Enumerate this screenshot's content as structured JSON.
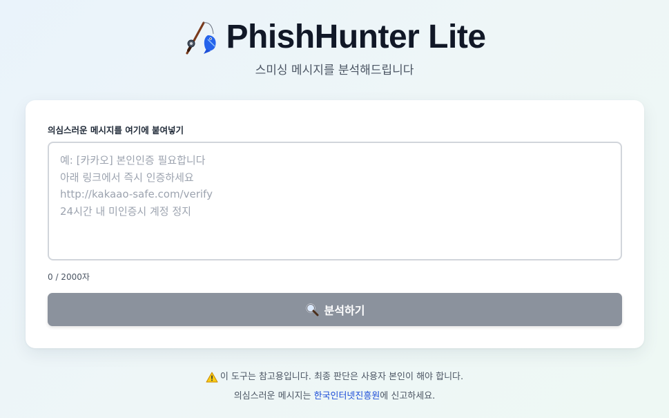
{
  "header": {
    "logo_icon": "fishing-pole-and-fish-icon",
    "title": "PhishHunter Lite",
    "subtitle": "스미싱 메시지를 분석해드립니다"
  },
  "form": {
    "label": "의심스러운 메시지를 여기에 붙여넣기",
    "placeholder": "예: [카카오] 본인인증 필요합니다\n아래 링크에서 즉시 인증하세요\nhttp://kakaao-safe.com/verify\n24시간 내 미인증시 계정 정지",
    "value": "",
    "counter": "0 / 2000자",
    "button_icon": "magnifying-glass-icon",
    "button_label": "분석하기"
  },
  "footer": {
    "warning_icon": "warning-icon",
    "disclaimer": "이 도구는 참고용입니다. 최종 판단은 사용자 본인이 해야 합니다.",
    "report_prefix": "의심스러운 메시지는 ",
    "report_link": "한국인터넷진흥원",
    "report_suffix": "에 신고하세요."
  },
  "colors": {
    "button_bg": "#8b929d",
    "link": "#1d4ed8",
    "title": "#111827"
  }
}
